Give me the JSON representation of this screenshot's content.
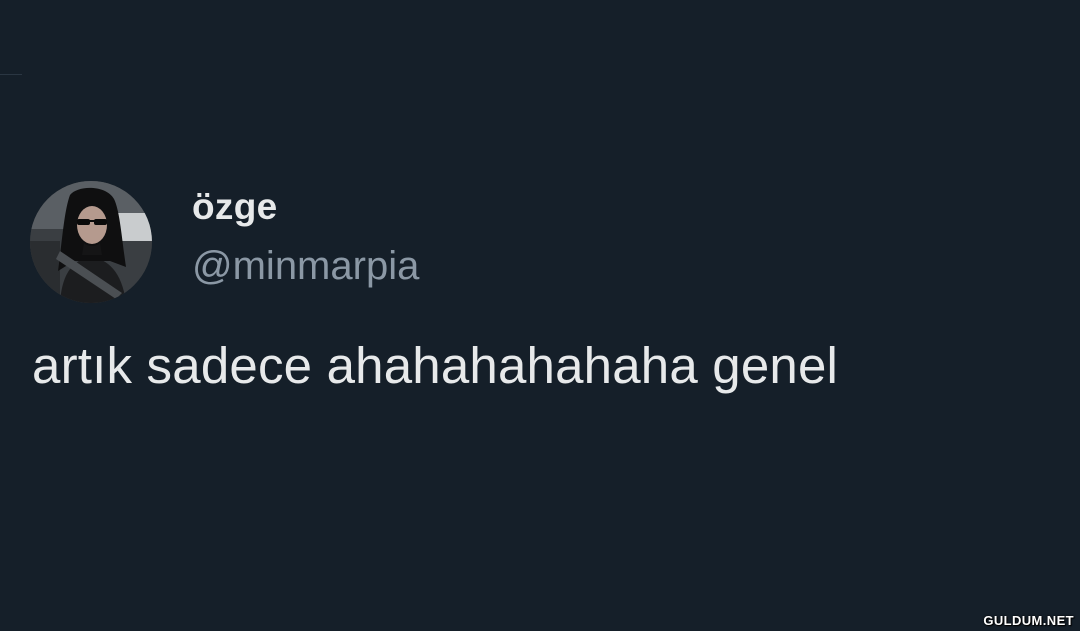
{
  "tweet": {
    "display_name": "özge",
    "handle": "@minmarpia",
    "text": "artık sadece ahahahahahaha genel"
  },
  "watermark": "GULDUM.NET",
  "icons": {
    "avatar": "profile-photo"
  },
  "colors": {
    "background": "#151f29",
    "primary_text": "#e7e9ea",
    "secondary_text": "#8b98a5"
  }
}
